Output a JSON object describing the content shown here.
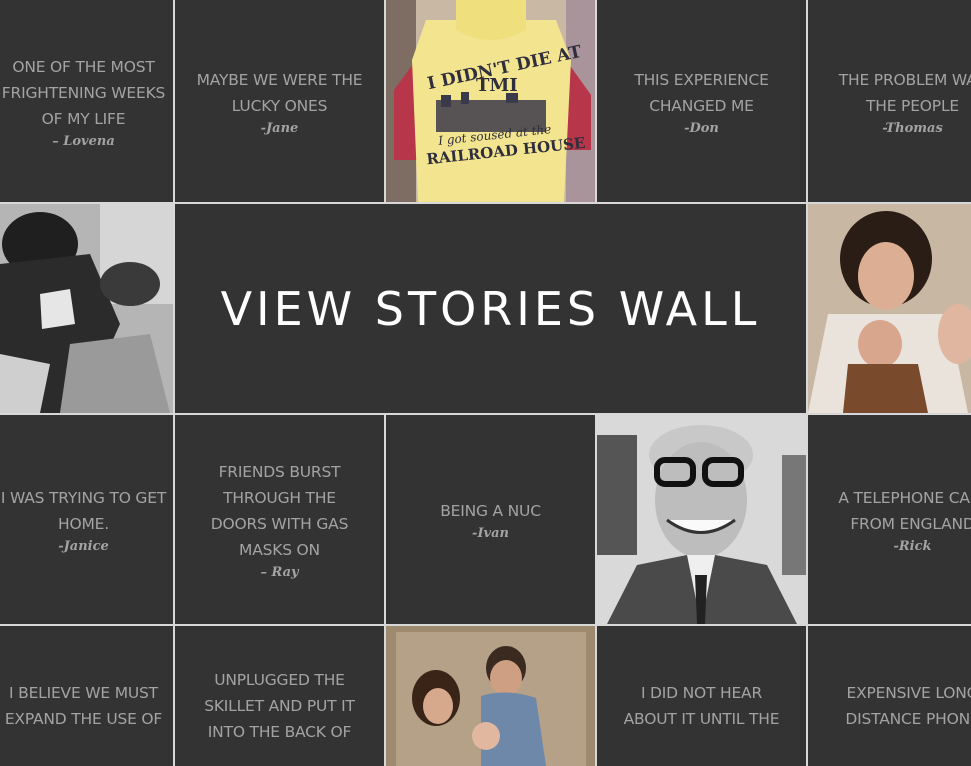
{
  "center": {
    "title": "VIEW STORIES WALL"
  },
  "tiles": {
    "r1c1": {
      "lines": [
        "ONE OF THE MOST",
        "FRIGHTENING WEEKS",
        "OF MY LIFE"
      ],
      "author": "– Lovena"
    },
    "r1c2": {
      "lines": [
        "MAYBE WE WERE THE",
        "LUCKY ONES"
      ],
      "author": "-Jane"
    },
    "r1c4": {
      "lines": [
        "THIS EXPERIENCE",
        "CHANGED ME"
      ],
      "author": "-Don"
    },
    "r1c5": {
      "lines": [
        "THE PROBLEM WAS",
        "THE PEOPLE"
      ],
      "author": "-Thomas"
    },
    "r3c1": {
      "lines": [
        "I WAS TRYING TO GET",
        "HOME."
      ],
      "author": "-Janice"
    },
    "r3c2": {
      "lines": [
        "FRIENDS BURST",
        "THROUGH THE",
        "DOORS WITH GAS",
        "MASKS ON"
      ],
      "author": "– Ray"
    },
    "r3c3": {
      "lines": [
        "BEING A NUC"
      ],
      "author": "-Ivan"
    },
    "r3c5": {
      "lines": [
        "A TELEPHONE CALL",
        "FROM ENGLAND"
      ],
      "author": "-Rick"
    },
    "r4c1": {
      "lines": [
        "I BELIEVE WE MUST",
        "EXPAND THE USE OF"
      ]
    },
    "r4c2": {
      "lines": [
        "UNPLUGGED THE",
        "SKILLET AND PUT IT",
        "INTO THE BACK OF"
      ]
    },
    "r4c4": {
      "lines": [
        "I DID NOT HEAR",
        "ABOUT IT UNTIL THE"
      ]
    },
    "r4c5": {
      "lines": [
        "EXPENSIVE LONG",
        "DISTANCE PHONE"
      ]
    }
  },
  "photos": {
    "tshirt": {
      "line1": "I DIDN'T DIE AT",
      "line2": "TMI",
      "line3": "I got soused at the",
      "line4": "RAILROAD HOUSE"
    }
  },
  "colors": {
    "tile": "#333333",
    "text": "#a3a3a3",
    "title": "#ffffff",
    "gap": "#d8d8d8"
  }
}
